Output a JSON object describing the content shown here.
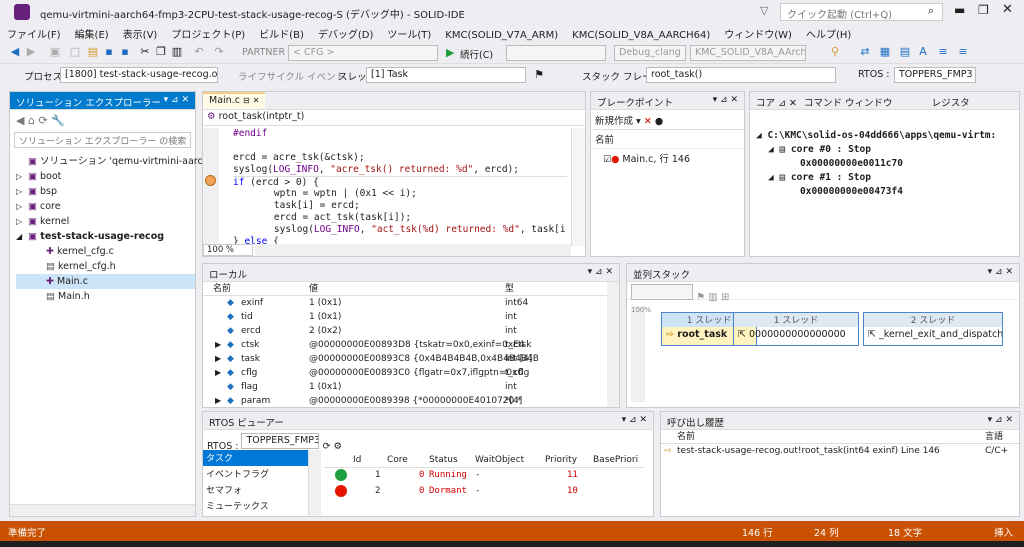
{
  "window": {
    "title": "qemu-virtmini-aarch64-fmp3-2CPU-test-stack-usage-recog-S (デバッグ中) - SOLID-IDE",
    "quick_launch": "クイック起動 (Ctrl+Q)"
  },
  "menu": [
    "ファイル(F)",
    "編集(E)",
    "表示(V)",
    "プロジェクト(P)",
    "ビルド(B)",
    "デバッグ(D)",
    "ツール(T)",
    "KMC(SOLID_V7A_ARM)",
    "KMC(SOLID_V8A_AARCH64)",
    "ウィンドウ(W)",
    "ヘルプ(H)"
  ],
  "toolbar": {
    "partner": "PARTNER",
    "cfg": "< CFG >",
    "continue": "続行(C)",
    "config": "Debug_clang",
    "platform": "KMC_SOLID_V8A_AArch64"
  },
  "toolbar2": {
    "process_label": "プロセス",
    "process": "[1800] test-stack-usage-recog.out",
    "lifecycle": "ライフサイクル イベント",
    "thread_label": "スレッド",
    "thread": "[1] Task",
    "stackframe_label": "スタック フレーム",
    "stackframe": "root_task()",
    "rtos_label": "RTOS :",
    "rtos": "TOPPERS_FMP3"
  },
  "solution_explorer": {
    "title": "ソリューション エクスプローラー",
    "search": "ソリューション エクスプローラー の検索 (Ctrl",
    "solution": "ソリューション 'qemu-virtmini-aarch64-fm",
    "items": [
      "boot",
      "bsp",
      "core",
      "kernel"
    ],
    "project": "test-stack-usage-recog",
    "files": [
      "kernel_cfg.c",
      "kernel_cfg.h",
      "Main.c",
      "Main.h"
    ]
  },
  "editor": {
    "tab": "Main.c",
    "func": "root_task(intptr_t)",
    "zoom": "100 %",
    "lines": [
      {
        "t": "#endif",
        "c": "mac"
      },
      {
        "t": ""
      },
      {
        "t": "ercd = acre_tsk(&ctsk);"
      },
      {
        "t": "syslog(LOG_INFO, \"acre_tsk() returned: %d\", ercd);"
      },
      {
        "t": "if (ercd > 0) {"
      },
      {
        "t": "    wptn = wptn | (0x1 << i);"
      },
      {
        "t": "    task[i] = ercd;"
      },
      {
        "t": "    ercd = act_tsk(task[i]);"
      },
      {
        "t": "    syslog(LOG_INFO, \"act_tsk(%d) returned: %d\", task[i],"
      },
      {
        "t": "} else {"
      }
    ]
  },
  "breakpoints": {
    "title": "ブレークポイント",
    "new": "新規作成",
    "col": "名前",
    "item": "Main.c, 行 146"
  },
  "core_panel": {
    "tabs": [
      "コア",
      "コマンド ウィンドウ",
      "レジスタ"
    ],
    "root": "C:\\KMC\\solid-os-04dd666\\apps\\qemu-virtm:",
    "cores": [
      {
        "name": "core #0 : Stop",
        "addr": "0x00000000e0011c70"
      },
      {
        "name": "core #1 : Stop",
        "addr": "0x00000000e00473f4"
      }
    ]
  },
  "locals": {
    "title": "ローカル",
    "cols": [
      "名前",
      "値",
      "型"
    ],
    "rows": [
      {
        "exp": "",
        "name": "exinf",
        "value": "1 (0x1)",
        "type": "int64"
      },
      {
        "exp": "",
        "name": "tid",
        "value": "1 (0x1)",
        "type": "int"
      },
      {
        "exp": "",
        "name": "ercd",
        "value": "2 (0x2)",
        "type": "int"
      },
      {
        "exp": "▶",
        "name": "ctsk",
        "value": "@00000000E00893D8 {tskatr=0x0,exinf=0xE4",
        "type": "t_ctsk"
      },
      {
        "exp": "▶",
        "name": "task",
        "value": "@00000000E00893C8 {0x4B4B4B4B,0x4B4B4B4B",
        "type": "int [4]"
      },
      {
        "exp": "▶",
        "name": "cflg",
        "value": "@00000000E00893C0 {flgatr=0x7,iflgptn=0x0",
        "type": "t_cflg"
      },
      {
        "exp": "",
        "name": "flag",
        "value": "1 (0x1)",
        "type": "int"
      },
      {
        "exp": "▶",
        "name": "param",
        "value": "@00000000E0089398 {*00000000E4010720 *",
        "type": "*[4]"
      }
    ]
  },
  "parallel_stacks": {
    "title": "並列スタック",
    "zoom_label": "100%",
    "boxes": [
      {
        "head": "1 スレッド",
        "body": "root_task"
      },
      {
        "head": "1 スレッド",
        "body": "0000000000000000"
      },
      {
        "head": "2 スレッド",
        "body": "_kernel_exit_and_dispatch"
      }
    ]
  },
  "rtos_viewer": {
    "title": "RTOS ビューアー",
    "rtos_label": "RTOS :",
    "rtos": "TOPPERS_FMP3",
    "categories": [
      "タスク",
      "イベントフラグ",
      "セマフォ",
      "ミューテックス"
    ],
    "cols": [
      "Id",
      "Core",
      "Status",
      "WaitObject",
      "Priority",
      "BasePriori"
    ],
    "rows": [
      {
        "id": "1",
        "core": "0",
        "status": "Running",
        "wait": "-",
        "prio": "11",
        "state": "run"
      },
      {
        "id": "2",
        "core": "0",
        "status": "Dormant",
        "wait": "-",
        "prio": "10",
        "state": "stop"
      }
    ]
  },
  "callstack": {
    "title": "呼び出し履歴",
    "cols": [
      "名前",
      "言語"
    ],
    "row": {
      "name": "test-stack-usage-recog.out!root_task(int64 exinf) Line 146",
      "lang": "C/C+"
    }
  },
  "status": {
    "ready": "準備完了",
    "line": "146 行",
    "col": "24 列",
    "ch": "18 文字",
    "ins": "挿入"
  },
  "colors": {
    "accent": "#007acc",
    "status": "#ca5100",
    "bg": "#eeeef2"
  }
}
